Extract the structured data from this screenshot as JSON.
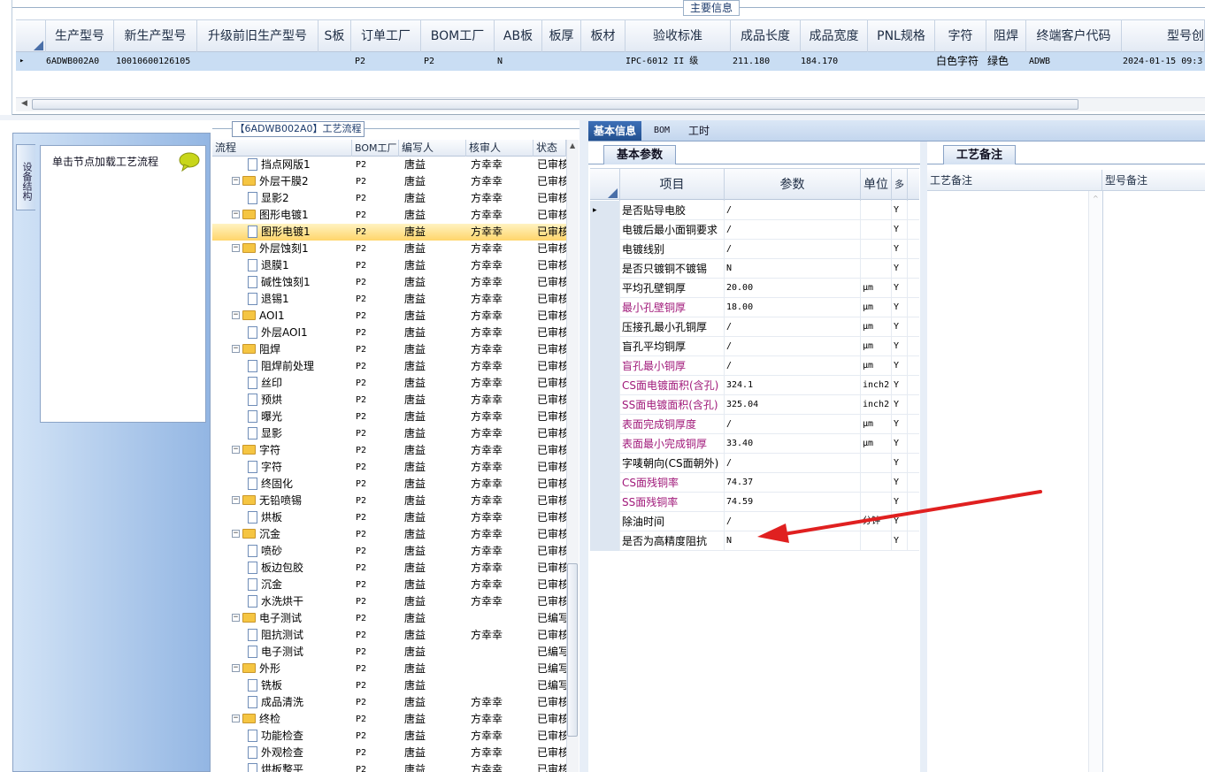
{
  "top": {
    "title": "主要信息",
    "columns": [
      "生产型号",
      "新生产型号",
      "升级前旧生产型号",
      "S板",
      "订单工厂",
      "BOM工厂",
      "AB板",
      "板厚",
      "板材",
      "验收标准",
      "成品长度",
      "成品宽度",
      "PNL规格",
      "字符",
      "阻焊",
      "终端客户代码",
      "型号创"
    ],
    "row": {
      "indicator": "▸",
      "prod_no": "6ADWB002A0",
      "new_prod_no": "10010600126105",
      "old_prod_no": "",
      "s_board": "",
      "order_factory": "P2",
      "bom_factory": "P2",
      "ab_board": "N",
      "thickness": "",
      "material": "",
      "standard": "IPC-6012 II 级",
      "length": "211.180",
      "width": "184.170",
      "pnl": "",
      "char": "白色字符",
      "solder": "绿色",
      "customer": "ADWB",
      "created": "2024-01-15 09:3"
    }
  },
  "left": {
    "vtab": "设备结构",
    "node_hint": "单击节点加载工艺流程"
  },
  "flow": {
    "title": "【6ADWB002A0】工艺流程",
    "headers": {
      "flow": "流程",
      "bom": "BOM工厂",
      "author": "编写人",
      "reviewer": "核审人",
      "status": "状态"
    },
    "rows": [
      {
        "name": "挡点网版1",
        "type": "doc",
        "level": 2,
        "bom": "P2",
        "author": "唐益",
        "reviewer": "方幸幸",
        "status": "已审核"
      },
      {
        "name": "外层干膜2",
        "type": "folder",
        "level": 1,
        "bom": "P2",
        "author": "唐益",
        "reviewer": "方幸幸",
        "status": "已审核"
      },
      {
        "name": "显影2",
        "type": "doc",
        "level": 2,
        "bom": "P2",
        "author": "唐益",
        "reviewer": "方幸幸",
        "status": "已审核"
      },
      {
        "name": "图形电镀1",
        "type": "folder",
        "level": 1,
        "bom": "P2",
        "author": "唐益",
        "reviewer": "方幸幸",
        "status": "已审核"
      },
      {
        "name": "图形电镀1",
        "type": "doc",
        "level": 2,
        "bom": "P2",
        "author": "唐益",
        "reviewer": "方幸幸",
        "status": "已审核",
        "selected": true
      },
      {
        "name": "外层蚀刻1",
        "type": "folder",
        "level": 1,
        "bom": "P2",
        "author": "唐益",
        "reviewer": "方幸幸",
        "status": "已审核"
      },
      {
        "name": "退膜1",
        "type": "doc",
        "level": 2,
        "bom": "P2",
        "author": "唐益",
        "reviewer": "方幸幸",
        "status": "已审核"
      },
      {
        "name": "碱性蚀刻1",
        "type": "doc",
        "level": 2,
        "bom": "P2",
        "author": "唐益",
        "reviewer": "方幸幸",
        "status": "已审核"
      },
      {
        "name": "退锡1",
        "type": "doc",
        "level": 2,
        "bom": "P2",
        "author": "唐益",
        "reviewer": "方幸幸",
        "status": "已审核"
      },
      {
        "name": "AOI1",
        "type": "folder",
        "level": 1,
        "bom": "P2",
        "author": "唐益",
        "reviewer": "方幸幸",
        "status": "已审核"
      },
      {
        "name": "外层AOI1",
        "type": "doc",
        "level": 2,
        "bom": "P2",
        "author": "唐益",
        "reviewer": "方幸幸",
        "status": "已审核"
      },
      {
        "name": "阻焊",
        "type": "folder",
        "level": 1,
        "bom": "P2",
        "author": "唐益",
        "reviewer": "方幸幸",
        "status": "已审核"
      },
      {
        "name": "阻焊前处理",
        "type": "doc",
        "level": 2,
        "bom": "P2",
        "author": "唐益",
        "reviewer": "方幸幸",
        "status": "已审核"
      },
      {
        "name": "丝印",
        "type": "doc",
        "level": 2,
        "bom": "P2",
        "author": "唐益",
        "reviewer": "方幸幸",
        "status": "已审核"
      },
      {
        "name": "预烘",
        "type": "doc",
        "level": 2,
        "bom": "P2",
        "author": "唐益",
        "reviewer": "方幸幸",
        "status": "已审核"
      },
      {
        "name": "曝光",
        "type": "doc",
        "level": 2,
        "bom": "P2",
        "author": "唐益",
        "reviewer": "方幸幸",
        "status": "已审核"
      },
      {
        "name": "显影",
        "type": "doc",
        "level": 2,
        "bom": "P2",
        "author": "唐益",
        "reviewer": "方幸幸",
        "status": "已审核"
      },
      {
        "name": "字符",
        "type": "folder",
        "level": 1,
        "bom": "P2",
        "author": "唐益",
        "reviewer": "方幸幸",
        "status": "已审核"
      },
      {
        "name": "字符",
        "type": "doc",
        "level": 2,
        "bom": "P2",
        "author": "唐益",
        "reviewer": "方幸幸",
        "status": "已审核"
      },
      {
        "name": "终固化",
        "type": "doc",
        "level": 2,
        "bom": "P2",
        "author": "唐益",
        "reviewer": "方幸幸",
        "status": "已审核"
      },
      {
        "name": "无铅喷锡",
        "type": "folder",
        "level": 1,
        "bom": "P2",
        "author": "唐益",
        "reviewer": "方幸幸",
        "status": "已审核"
      },
      {
        "name": "烘板",
        "type": "doc",
        "level": 2,
        "bom": "P2",
        "author": "唐益",
        "reviewer": "方幸幸",
        "status": "已审核"
      },
      {
        "name": "沉金",
        "type": "folder",
        "level": 1,
        "bom": "P2",
        "author": "唐益",
        "reviewer": "方幸幸",
        "status": "已审核"
      },
      {
        "name": "喷砂",
        "type": "doc",
        "level": 2,
        "bom": "P2",
        "author": "唐益",
        "reviewer": "方幸幸",
        "status": "已审核"
      },
      {
        "name": "板边包胶",
        "type": "doc",
        "level": 2,
        "bom": "P2",
        "author": "唐益",
        "reviewer": "方幸幸",
        "status": "已审核"
      },
      {
        "name": "沉金",
        "type": "doc",
        "level": 2,
        "bom": "P2",
        "author": "唐益",
        "reviewer": "方幸幸",
        "status": "已审核"
      },
      {
        "name": "水洗烘干",
        "type": "doc",
        "level": 2,
        "bom": "P2",
        "author": "唐益",
        "reviewer": "方幸幸",
        "status": "已审核"
      },
      {
        "name": "电子测试",
        "type": "folder",
        "level": 1,
        "bom": "P2",
        "author": "唐益",
        "reviewer": "",
        "status": "已编写"
      },
      {
        "name": "阻抗测试",
        "type": "doc",
        "level": 2,
        "bom": "P2",
        "author": "唐益",
        "reviewer": "方幸幸",
        "status": "已审核"
      },
      {
        "name": "电子测试",
        "type": "doc",
        "level": 2,
        "bom": "P2",
        "author": "唐益",
        "reviewer": "",
        "status": "已编写"
      },
      {
        "name": "外形",
        "type": "folder",
        "level": 1,
        "bom": "P2",
        "author": "唐益",
        "reviewer": "",
        "status": "已编写"
      },
      {
        "name": "铣板",
        "type": "doc",
        "level": 2,
        "bom": "P2",
        "author": "唐益",
        "reviewer": "",
        "status": "已编写"
      },
      {
        "name": "成品清洗",
        "type": "doc",
        "level": 2,
        "bom": "P2",
        "author": "唐益",
        "reviewer": "方幸幸",
        "status": "已审核"
      },
      {
        "name": "终检",
        "type": "folder",
        "level": 1,
        "bom": "P2",
        "author": "唐益",
        "reviewer": "方幸幸",
        "status": "已审核"
      },
      {
        "name": "功能检查",
        "type": "doc",
        "level": 2,
        "bom": "P2",
        "author": "唐益",
        "reviewer": "方幸幸",
        "status": "已审核"
      },
      {
        "name": "外观检查",
        "type": "doc",
        "level": 2,
        "bom": "P2",
        "author": "唐益",
        "reviewer": "方幸幸",
        "status": "已审核"
      },
      {
        "name": "烘板整平",
        "type": "doc",
        "level": 2,
        "bom": "P2",
        "author": "唐益",
        "reviewer": "方幸幸",
        "status": "已审核"
      }
    ]
  },
  "right": {
    "tabs": [
      {
        "label": "基本信息",
        "active": true
      },
      {
        "label": "BOM",
        "active": false
      },
      {
        "label": "工时",
        "active": false
      }
    ],
    "subtab": "基本参数",
    "headers": {
      "item": "项目",
      "param": "参数",
      "unit": "单位",
      "extra": "多"
    },
    "rows": [
      {
        "item": "是否贴导电胶",
        "param": "/",
        "unit": "",
        "y": "Y",
        "mag": false,
        "ind": "▸"
      },
      {
        "item": "电镀后最小面铜要求",
        "param": "/",
        "unit": "",
        "y": "Y",
        "mag": false
      },
      {
        "item": "电镀线别",
        "param": "/",
        "unit": "",
        "y": "Y",
        "mag": false
      },
      {
        "item": "是否只镀铜不镀锡",
        "param": "N",
        "unit": "",
        "y": "Y",
        "mag": false
      },
      {
        "item": "平均孔壁铜厚",
        "param": "20.00",
        "unit": "μm",
        "y": "Y",
        "mag": false
      },
      {
        "item": "最小孔壁铜厚",
        "param": "18.00",
        "unit": "μm",
        "y": "Y",
        "mag": true
      },
      {
        "item": "压接孔最小孔铜厚",
        "param": "/",
        "unit": "μm",
        "y": "Y",
        "mag": false
      },
      {
        "item": "盲孔平均铜厚",
        "param": "/",
        "unit": "μm",
        "y": "Y",
        "mag": false
      },
      {
        "item": "盲孔最小铜厚",
        "param": "/",
        "unit": "μm",
        "y": "Y",
        "mag": true
      },
      {
        "item": "CS面电镀面积(含孔)",
        "param": "324.1",
        "unit": "inch2",
        "y": "Y",
        "mag": true
      },
      {
        "item": "SS面电镀面积(含孔)",
        "param": "325.04",
        "unit": "inch2",
        "y": "Y",
        "mag": true
      },
      {
        "item": "表面完成铜厚度",
        "param": "/",
        "unit": "μm",
        "y": "Y",
        "mag": true
      },
      {
        "item": "表面最小完成铜厚",
        "param": "33.40",
        "unit": "μm",
        "y": "Y",
        "mag": true
      },
      {
        "item": "字唛朝向(CS面朝外)",
        "param": "/",
        "unit": "",
        "y": "Y",
        "mag": false
      },
      {
        "item": "CS面残铜率",
        "param": "74.37",
        "unit": "",
        "y": "Y",
        "mag": true
      },
      {
        "item": "SS面残铜率",
        "param": "74.59",
        "unit": "",
        "y": "Y",
        "mag": true
      },
      {
        "item": "除油时间",
        "param": "/",
        "unit": "分钟",
        "y": "Y",
        "mag": false
      },
      {
        "item": "是否为高精度阻抗",
        "param": "N",
        "unit": "",
        "y": "Y",
        "mag": false
      }
    ],
    "notes": {
      "tab": "工艺备注",
      "col1": "工艺备注",
      "col2": "型号备注"
    }
  },
  "colors": {
    "accent": "#22508f",
    "selected": "#ffd56a",
    "magenta": "#a0197a",
    "arrow": "#e02020"
  }
}
